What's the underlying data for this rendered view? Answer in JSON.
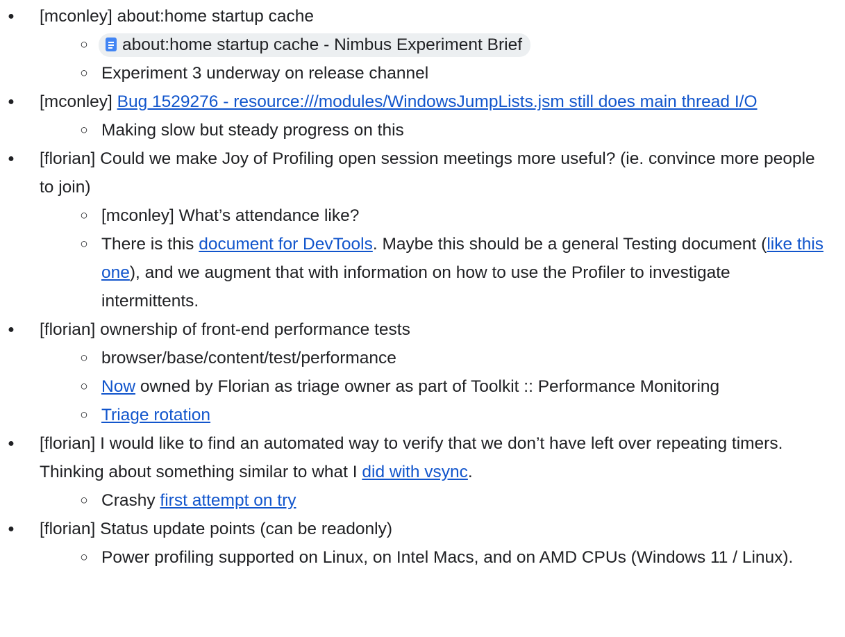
{
  "items": [
    {
      "text": "[mconley] about:home startup cache",
      "subs": [
        {
          "chip": "about:home startup cache - Nimbus Experiment Brief"
        },
        {
          "text": "Experiment 3 underway on release channel"
        }
      ]
    },
    {
      "prefix": "[mconley] ",
      "link": "Bug 1529276 - resource:///modules/WindowsJumpLists.jsm still does main thread I/O",
      "subs": [
        {
          "text": "Making slow but steady progress on this"
        }
      ]
    },
    {
      "text": "[florian] Could we make Joy of Profiling open session meetings more useful? (ie. convince more people to join)",
      "subs": [
        {
          "text": "[mconley] What’s attendance like?"
        },
        {
          "t1": "There is this ",
          "link1": "document for DevTools",
          "t2": ". Maybe this should be a general Testing document (",
          "link2": "like this one",
          "t3": "), and we augment that with information on how to use the Profiler to investigate intermittents."
        }
      ]
    },
    {
      "text": "[florian] ownership of front-end performance tests",
      "subs": [
        {
          "text": "browser/base/content/test/performance"
        },
        {
          "link": "Now",
          "text": " owned by Florian as triage owner as part of Toolkit :: Performance Monitoring"
        },
        {
          "link": "Triage rotation"
        }
      ]
    },
    {
      "t1": "[florian] I would like to find an automated way to verify that we don’t have left over repeating timers. Thinking about something similar to what I ",
      "link": "did with vsync",
      "t2": ".",
      "subs": [
        {
          "prefix": "Crashy ",
          "link": "first attempt on try"
        }
      ]
    },
    {
      "text": "[florian] Status update points (can be readonly)",
      "subs": [
        {
          "text": "Power profiling supported on Linux, on Intel Macs, and on AMD CPUs (Windows 11 / Linux)."
        }
      ]
    }
  ]
}
